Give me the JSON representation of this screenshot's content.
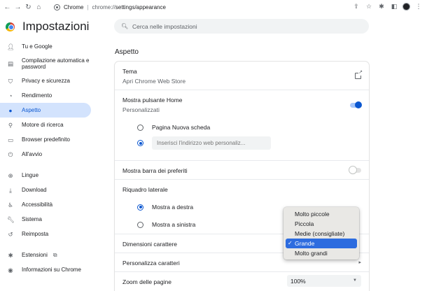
{
  "browser": {
    "host": "Chrome",
    "url_scheme": "chrome://",
    "url_path": "settings/appearance"
  },
  "app": {
    "title": "Impostazioni"
  },
  "search": {
    "placeholder": "Cerca nelle impostazioni"
  },
  "sidebar": {
    "items": [
      {
        "label": "Tu e Google",
        "icon": "person-icon"
      },
      {
        "label": "Compilazione automatica e password",
        "icon": "clipboard-icon"
      },
      {
        "label": "Privacy e sicurezza",
        "icon": "shield-icon"
      },
      {
        "label": "Rendimento",
        "icon": "speedometer-icon"
      },
      {
        "label": "Aspetto",
        "icon": "palette-icon",
        "active": true
      },
      {
        "label": "Motore di ricerca",
        "icon": "search-icon"
      },
      {
        "label": "Browser predefinito",
        "icon": "browser-icon"
      },
      {
        "label": "All'avvio",
        "icon": "power-icon"
      },
      {
        "label": "Lingue",
        "icon": "globe-icon"
      },
      {
        "label": "Download",
        "icon": "download-icon"
      },
      {
        "label": "Accessibilità",
        "icon": "accessibility-icon"
      },
      {
        "label": "Sistema",
        "icon": "wrench-icon"
      },
      {
        "label": "Reimposta",
        "icon": "reset-icon"
      },
      {
        "label": "Estensioni",
        "icon": "puzzle-icon"
      },
      {
        "label": "Informazioni su Chrome",
        "icon": "chrome-icon"
      }
    ]
  },
  "main": {
    "section_title": "Aspetto",
    "theme": {
      "title": "Tema",
      "subtitle": "Apri Chrome Web Store"
    },
    "home_button": {
      "title": "Mostra pulsante Home",
      "subtitle": "Personalizzati",
      "enabled": true,
      "option_new_tab": "Pagina Nuova scheda",
      "option_url_placeholder": "Inserisci l'indirizzo web personaliz..."
    },
    "bookmarks_bar": {
      "title": "Mostra barra dei preferiti",
      "enabled": false
    },
    "side_panel": {
      "title": "Riquadro laterale",
      "option_right": "Mostra a destra",
      "option_left": "Mostra a sinistra"
    },
    "font_size": {
      "title": "Dimensioni carattere"
    },
    "customize_fonts": {
      "title": "Personalizza caratteri"
    },
    "page_zoom": {
      "title": "Zoom delle pagine",
      "value": "100%"
    }
  },
  "dropdown": {
    "check": "✓",
    "options": [
      "Molto piccole",
      "Piccola",
      "Medie (consigliate)",
      "Grande",
      "Molto grandi"
    ],
    "selected": "Grande"
  },
  "colors": {
    "accent": "#0b57d0",
    "active_nav_bg": "#d3e3fd",
    "menu_highlight": "#2d6cdf"
  }
}
